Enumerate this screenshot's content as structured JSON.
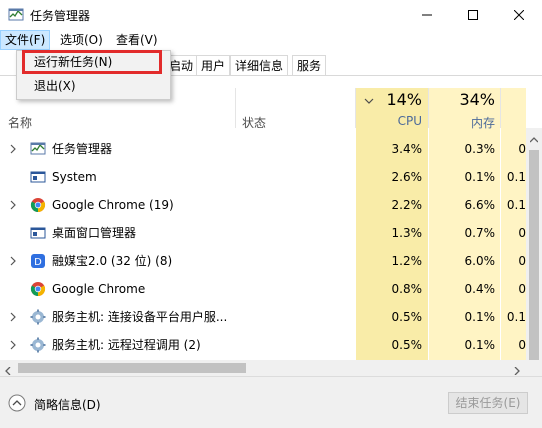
{
  "window": {
    "title": "任务管理器"
  },
  "menubar": {
    "file": "文件(F)",
    "options": "选项(O)",
    "view": "查看(V)"
  },
  "file_menu": {
    "run_new_task": "运行新任务(N)",
    "exit": "退出(X)"
  },
  "tabs": [
    {
      "label": "启动"
    },
    {
      "label": "用户"
    },
    {
      "label": "详细信息"
    },
    {
      "label": "服务"
    }
  ],
  "columns": {
    "name": "名称",
    "status": "状态",
    "cpu_pct": "14%",
    "cpu": "CPU",
    "mem_pct": "34%",
    "mem": "内存"
  },
  "rows": [
    {
      "name": "任务管理器",
      "cpu": "3.4%",
      "mem": "0.3%",
      "extra": "0",
      "expandable": true,
      "icon": "task-manager-icon"
    },
    {
      "name": "System",
      "cpu": "2.6%",
      "mem": "0.1%",
      "extra": "0.1",
      "expandable": false,
      "icon": "system-window-icon"
    },
    {
      "name": "Google Chrome (19)",
      "cpu": "2.2%",
      "mem": "6.6%",
      "extra": "0.1",
      "expandable": true,
      "icon": "chrome-icon"
    },
    {
      "name": "桌面窗口管理器",
      "cpu": "1.3%",
      "mem": "0.7%",
      "extra": "0",
      "expandable": false,
      "icon": "system-window-icon"
    },
    {
      "name": "融媒宝2.0 (32 位) (8)",
      "cpu": "1.2%",
      "mem": "6.0%",
      "extra": "0",
      "expandable": true,
      "icon": "rongmeibao-icon"
    },
    {
      "name": "Google Chrome",
      "cpu": "0.8%",
      "mem": "0.4%",
      "extra": "0",
      "expandable": false,
      "icon": "chrome-icon"
    },
    {
      "name": "服务主机: 连接设备平台用户服...",
      "cpu": "0.5%",
      "mem": "0.1%",
      "extra": "0.1",
      "expandable": true,
      "icon": "gear-icon"
    },
    {
      "name": "服务主机: 远程过程调用 (2)",
      "cpu": "0.5%",
      "mem": "0.1%",
      "extra": "0",
      "expandable": true,
      "icon": "gear-icon"
    }
  ],
  "footer": {
    "fewer_details": "简略信息(D)",
    "end_task": "结束任务(E)"
  }
}
